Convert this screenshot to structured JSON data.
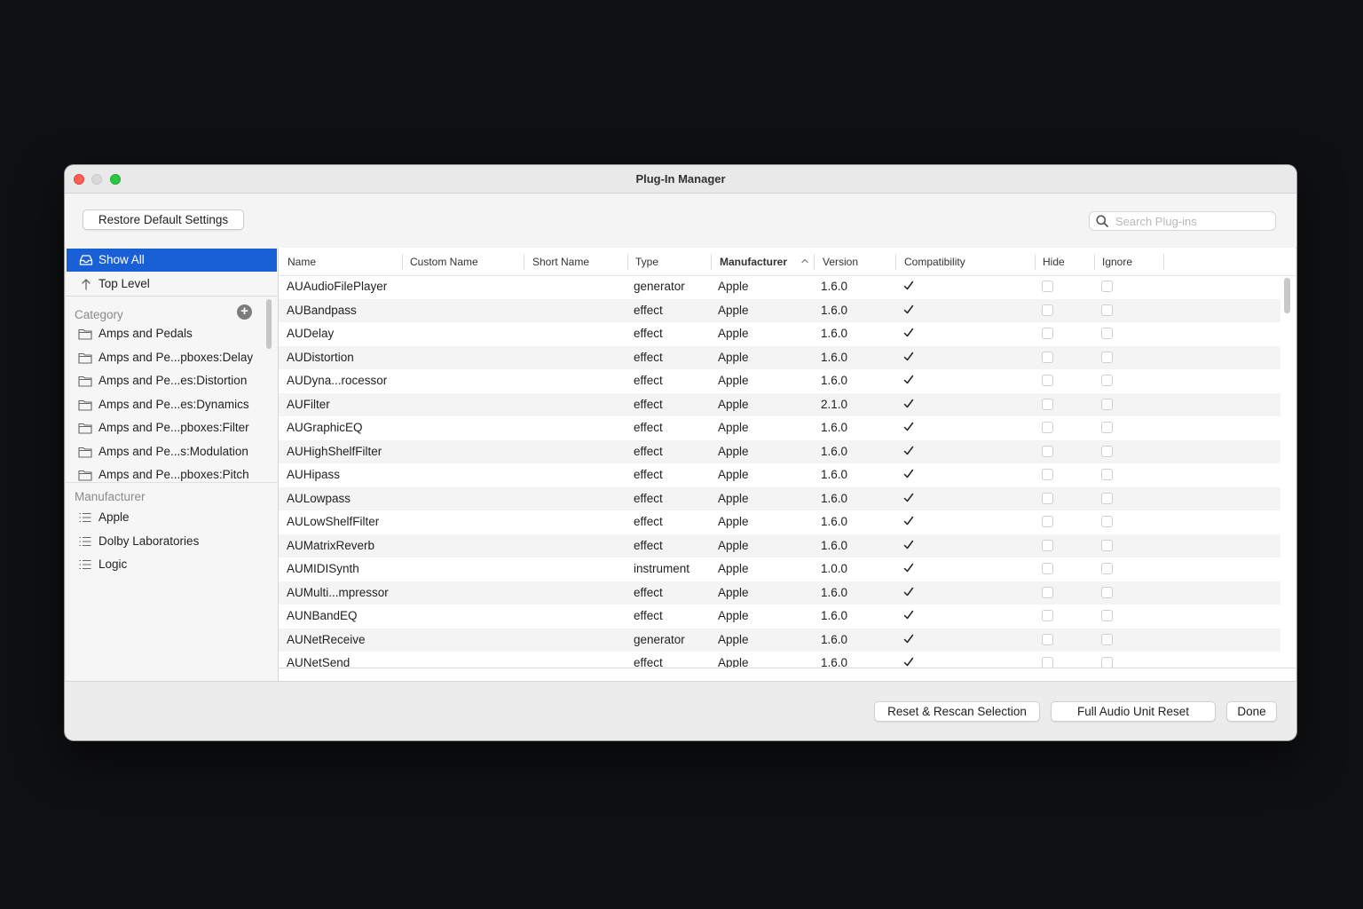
{
  "window": {
    "title": "Plug-In Manager"
  },
  "toolbar": {
    "restore_label": "Restore Default Settings",
    "search_placeholder": "Search Plug-ins",
    "search_icon": "magnifying-glass"
  },
  "sidebar": {
    "nav": [
      {
        "label": "Show All",
        "icon": "tray-icon",
        "selected": true
      },
      {
        "label": "Top Level",
        "icon": "arrow-up-icon",
        "selected": false
      }
    ],
    "category_header": "Category",
    "add_label": "+",
    "categories": [
      "Amps and Pedals",
      "Amps and Pe...pboxes:Delay",
      "Amps and Pe...es:Distortion",
      "Amps and Pe...es:Dynamics",
      "Amps and Pe...pboxes:Filter",
      "Amps and Pe...s:Modulation",
      "Amps and Pe...pboxes:Pitch"
    ],
    "manufacturer_header": "Manufacturer",
    "manufacturers": [
      "Apple",
      "Dolby Laboratories",
      "Logic"
    ]
  },
  "table": {
    "columns": [
      "Name",
      "Custom Name",
      "Short Name",
      "Type",
      "Manufacturer",
      "Version",
      "Compatibility",
      "Hide",
      "Ignore"
    ],
    "sorted_column": "Manufacturer",
    "rows": [
      {
        "name": "AUAudioFilePlayer",
        "type": "generator",
        "manufacturer": "Apple",
        "version": "1.6.0",
        "compatible": true
      },
      {
        "name": "AUBandpass",
        "type": "effect",
        "manufacturer": "Apple",
        "version": "1.6.0",
        "compatible": true
      },
      {
        "name": "AUDelay",
        "type": "effect",
        "manufacturer": "Apple",
        "version": "1.6.0",
        "compatible": true
      },
      {
        "name": "AUDistortion",
        "type": "effect",
        "manufacturer": "Apple",
        "version": "1.6.0",
        "compatible": true
      },
      {
        "name": "AUDyna...rocessor",
        "type": "effect",
        "manufacturer": "Apple",
        "version": "1.6.0",
        "compatible": true
      },
      {
        "name": "AUFilter",
        "type": "effect",
        "manufacturer": "Apple",
        "version": "2.1.0",
        "compatible": true
      },
      {
        "name": "AUGraphicEQ",
        "type": "effect",
        "manufacturer": "Apple",
        "version": "1.6.0",
        "compatible": true
      },
      {
        "name": "AUHighShelfFilter",
        "type": "effect",
        "manufacturer": "Apple",
        "version": "1.6.0",
        "compatible": true
      },
      {
        "name": "AUHipass",
        "type": "effect",
        "manufacturer": "Apple",
        "version": "1.6.0",
        "compatible": true
      },
      {
        "name": "AULowpass",
        "type": "effect",
        "manufacturer": "Apple",
        "version": "1.6.0",
        "compatible": true
      },
      {
        "name": "AULowShelfFilter",
        "type": "effect",
        "manufacturer": "Apple",
        "version": "1.6.0",
        "compatible": true
      },
      {
        "name": "AUMatrixReverb",
        "type": "effect",
        "manufacturer": "Apple",
        "version": "1.6.0",
        "compatible": true
      },
      {
        "name": "AUMIDISynth",
        "type": "instrument",
        "manufacturer": "Apple",
        "version": "1.0.0",
        "compatible": true
      },
      {
        "name": "AUMulti...mpressor",
        "type": "effect",
        "manufacturer": "Apple",
        "version": "1.6.0",
        "compatible": true
      },
      {
        "name": "AUNBandEQ",
        "type": "effect",
        "manufacturer": "Apple",
        "version": "1.6.0",
        "compatible": true
      },
      {
        "name": "AUNetReceive",
        "type": "generator",
        "manufacturer": "Apple",
        "version": "1.6.0",
        "compatible": true
      },
      {
        "name": "AUNetSend",
        "type": "effect",
        "manufacturer": "Apple",
        "version": "1.6.0",
        "compatible": true
      }
    ]
  },
  "footer": {
    "rescan_label": "Reset & Rescan Selection",
    "full_reset_label": "Full Audio Unit Reset",
    "done_label": "Done"
  },
  "colors": {
    "accent": "#1960d6",
    "close": "#fe5f57",
    "maximize": "#28c840"
  }
}
